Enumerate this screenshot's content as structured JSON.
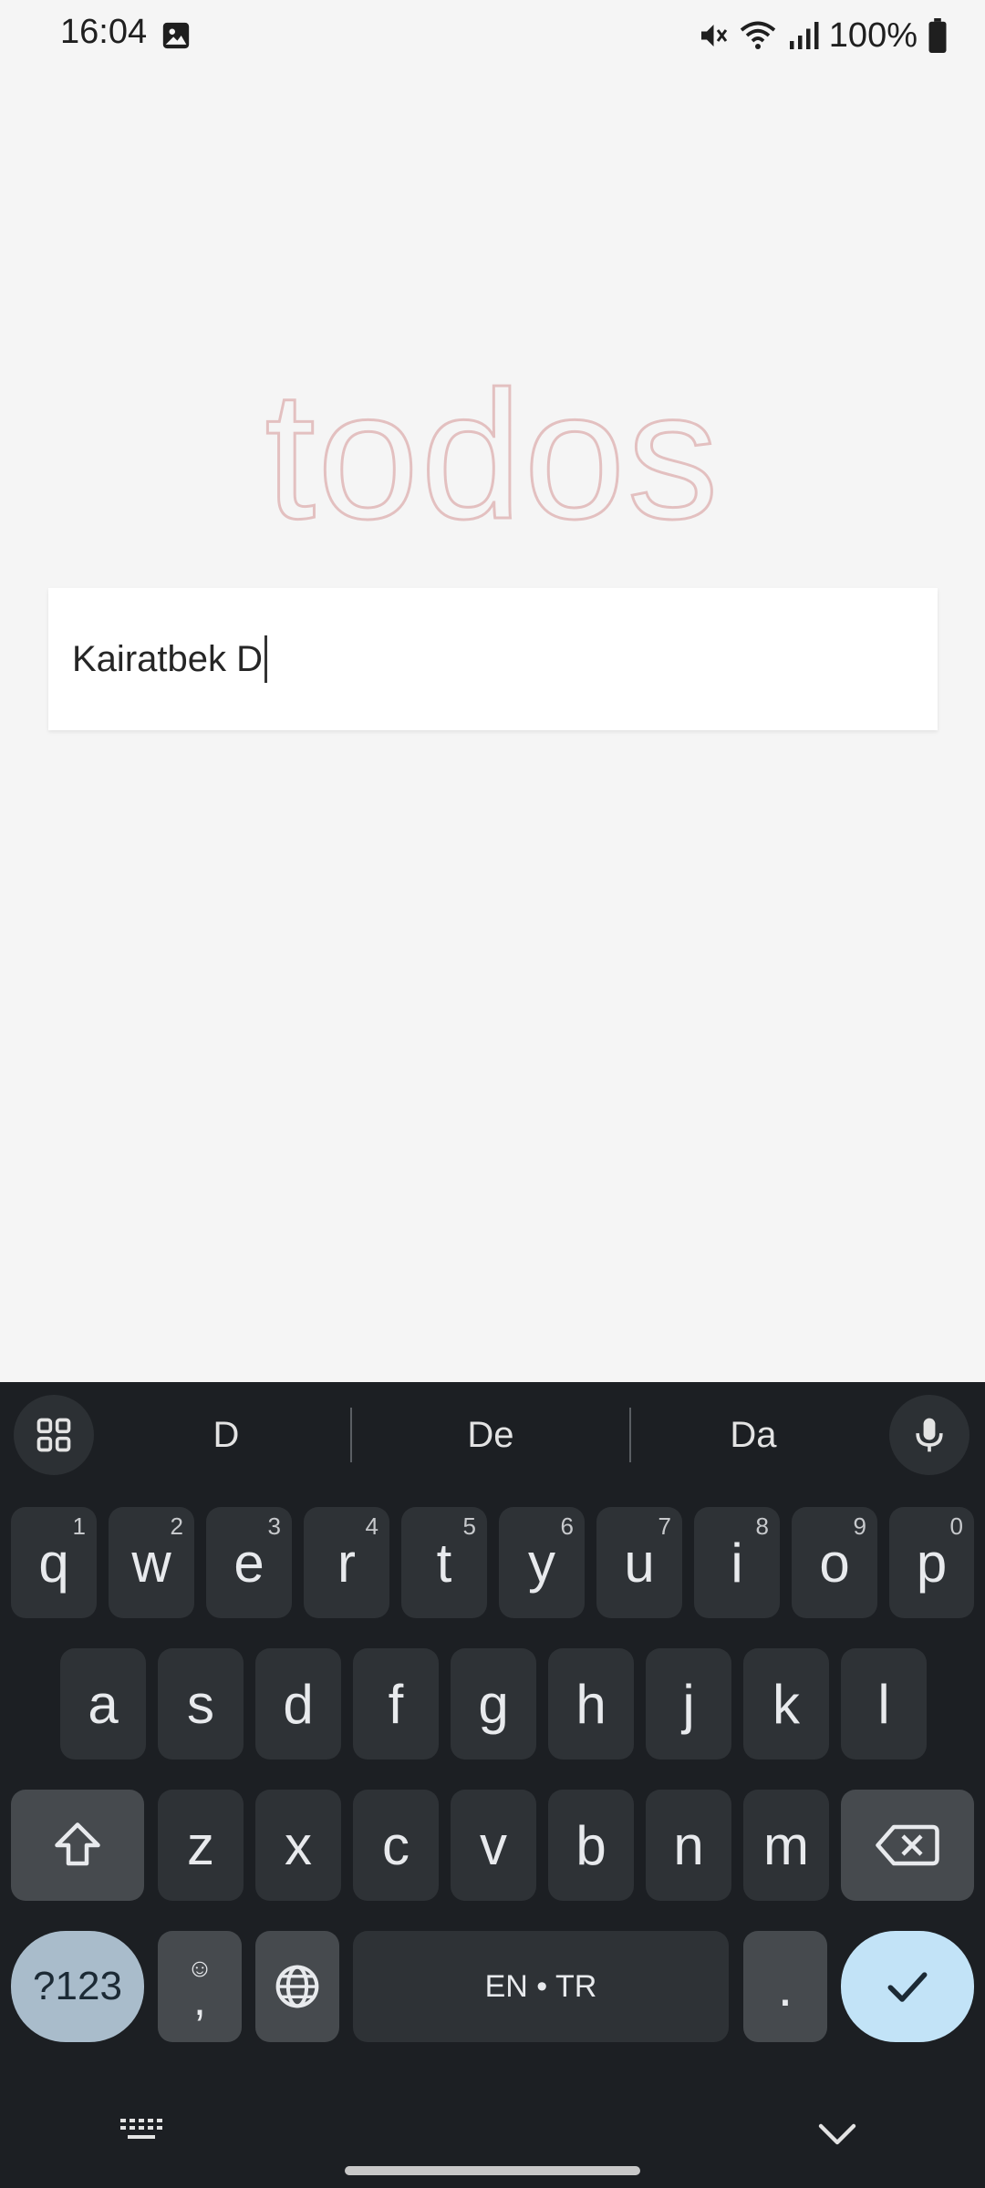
{
  "status_bar": {
    "time": "16:04",
    "battery": "100%",
    "icons": [
      "image-icon",
      "mute-icon",
      "wifi-icon",
      "signal-icon",
      "battery-icon"
    ]
  },
  "app": {
    "title": "todos",
    "input_value": "Kairatbek D"
  },
  "keyboard": {
    "suggestions": [
      "D",
      "De",
      "Da"
    ],
    "row1": [
      {
        "key": "q",
        "hint": "1"
      },
      {
        "key": "w",
        "hint": "2"
      },
      {
        "key": "e",
        "hint": "3"
      },
      {
        "key": "r",
        "hint": "4"
      },
      {
        "key": "t",
        "hint": "5"
      },
      {
        "key": "y",
        "hint": "6"
      },
      {
        "key": "u",
        "hint": "7"
      },
      {
        "key": "i",
        "hint": "8"
      },
      {
        "key": "o",
        "hint": "9"
      },
      {
        "key": "p",
        "hint": "0"
      }
    ],
    "row2": [
      "a",
      "s",
      "d",
      "f",
      "g",
      "h",
      "j",
      "k",
      "l"
    ],
    "row3": [
      "z",
      "x",
      "c",
      "v",
      "b",
      "n",
      "m"
    ],
    "symbols_label": "?123",
    "emoji_comma_label": ",",
    "space_label": "EN • TR",
    "period_label": "."
  },
  "colors": {
    "title": "#e8c8c8",
    "keyboard_bg": "#1c1f23",
    "key_bg": "#2e3236",
    "enter_bg": "#c2e3f7",
    "symbols_bg": "#a9bccb"
  }
}
